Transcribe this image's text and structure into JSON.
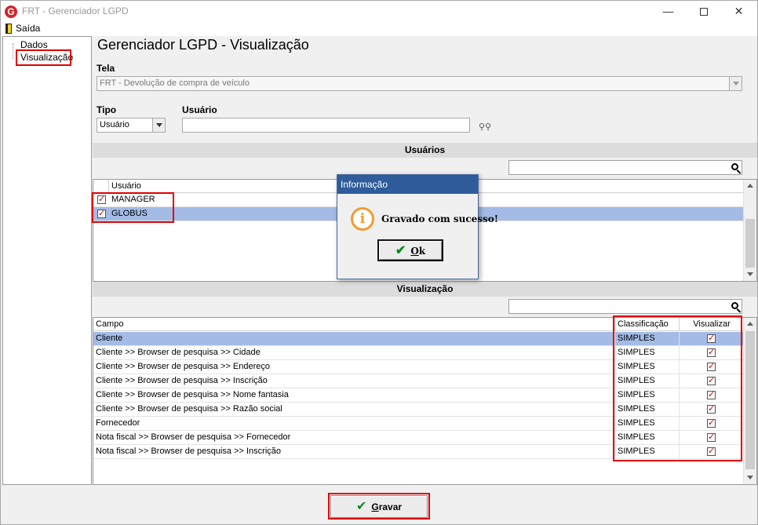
{
  "window": {
    "title": "FRT - Gerenciador LGPD",
    "app_icon": "G"
  },
  "menu": {
    "exit_label": "Saída"
  },
  "tree": {
    "items": [
      "Dados",
      "Visualização"
    ]
  },
  "page": {
    "heading": "Gerenciador LGPD - Visualização"
  },
  "form": {
    "tela_label": "Tela",
    "tela_value": "FRT - Devolução de compra de veículo",
    "tipo_label": "Tipo",
    "tipo_value": "Usuário",
    "usuario_label": "Usuário",
    "usuario_value": ""
  },
  "users_section": {
    "title": "Usuários",
    "column": "Usuário",
    "rows": [
      {
        "name": "MANAGER",
        "checked": true,
        "selected": false
      },
      {
        "name": "GLOBUS",
        "checked": true,
        "selected": true
      }
    ]
  },
  "view_section": {
    "title": "Visualização",
    "columns": [
      "Campo",
      "Classificação",
      "Visualizar"
    ],
    "rows": [
      {
        "campo": "Cliente",
        "classificacao": "SIMPLES",
        "visualizar": true
      },
      {
        "campo": "Cliente >> Browser de pesquisa >> Cidade",
        "classificacao": "SIMPLES",
        "visualizar": true
      },
      {
        "campo": "Cliente >> Browser de pesquisa >> Endereço",
        "classificacao": "SIMPLES",
        "visualizar": true
      },
      {
        "campo": "Cliente >> Browser de pesquisa >> Inscrição",
        "classificacao": "SIMPLES",
        "visualizar": true
      },
      {
        "campo": "Cliente >> Browser de pesquisa >> Nome fantasia",
        "classificacao": "SIMPLES",
        "visualizar": true
      },
      {
        "campo": "Cliente >> Browser de pesquisa >> Razão social",
        "classificacao": "SIMPLES",
        "visualizar": true
      },
      {
        "campo": "Fornecedor",
        "classificacao": "SIMPLES",
        "visualizar": true
      },
      {
        "campo": "Nota fiscal >> Browser de pesquisa >> Fornecedor",
        "classificacao": "SIMPLES",
        "visualizar": true
      },
      {
        "campo": "Nota fiscal >> Browser de pesquisa >> Inscrição",
        "classificacao": "SIMPLES",
        "visualizar": true
      }
    ]
  },
  "dialog": {
    "title": "Informação",
    "message": "Gravado com sucesso!",
    "ok_first": "O",
    "ok_rest": "k",
    "icon": "info-icon"
  },
  "footer": {
    "save_first": "G",
    "save_rest": "ravar"
  },
  "colors": {
    "highlight": "#e00000",
    "selection": "#a4bbe6",
    "dialog_title": "#2f5c9a",
    "check": "#d10000"
  }
}
